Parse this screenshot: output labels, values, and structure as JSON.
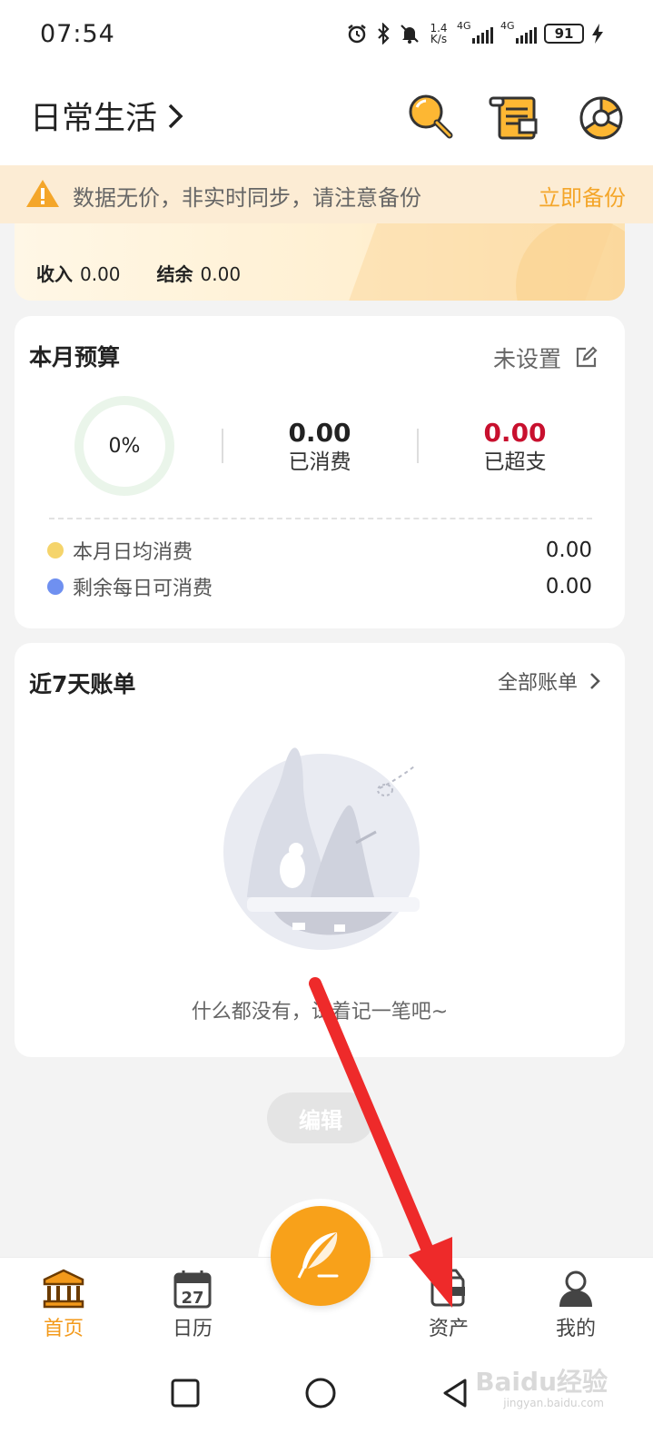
{
  "status_bar": {
    "time": "07:54",
    "speed_top": "1.4",
    "speed_unit": "K/s",
    "net1": "4G",
    "net2": "4G",
    "battery": "91",
    "icons": [
      "alarm-icon",
      "bluetooth-icon",
      "mute-icon",
      "signal-icon",
      "battery-icon",
      "charging-icon"
    ]
  },
  "header": {
    "book_title": "日常生活",
    "chevron": "›",
    "icons": [
      "search-icon",
      "bill-icon",
      "stats-pie-icon"
    ]
  },
  "banner": {
    "text": "数据无价，非实时同步，请注意备份",
    "action": "立即备份"
  },
  "summary": {
    "income_label": "收入",
    "income_value": "0.00",
    "balance_label": "结余",
    "balance_value": "0.00"
  },
  "budget": {
    "title": "本月预算",
    "status": "未设置",
    "percent": "0%",
    "progress": 0,
    "spent_value": "0.00",
    "spent_label": "已消费",
    "over_value": "0.00",
    "over_label": "已超支",
    "daily_avg_label": "本月日均消费",
    "daily_avg_value": "0.00",
    "daily_remaining_label": "剩余每日可消费",
    "daily_remaining_value": "0.00",
    "colors": {
      "over": "#c8102e",
      "avg_dot": "#f5d46b",
      "remaining_dot": "#6f90f0"
    }
  },
  "bills": {
    "title": "近7天账单",
    "all_link": "全部账单",
    "empty_text": "什么都没有，试着记一笔吧~"
  },
  "edit_button": "编辑",
  "tabbar": {
    "tabs": [
      {
        "label": "首页",
        "icon": "bank-icon",
        "active": true
      },
      {
        "label": "日历",
        "icon": "calendar-icon",
        "active": false
      },
      {
        "label": "资产",
        "icon": "wallet-icon",
        "active": false
      },
      {
        "label": "我的",
        "icon": "user-icon",
        "active": false
      }
    ],
    "calendar_day": "27",
    "fab_icon": "feather-pen-icon"
  },
  "watermark": {
    "main": "Baidu经验",
    "sub": "jingyan.baidu.com"
  },
  "colors": {
    "accent": "#f8a11a",
    "active_tab": "#f39a1b",
    "annotation_arrow": "#ee2a2a"
  }
}
